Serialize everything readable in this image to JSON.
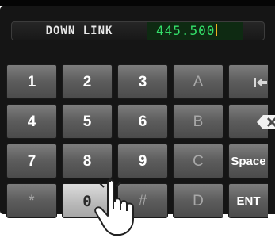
{
  "display": {
    "mode": "DOWN LINK",
    "frequency": "445.500"
  },
  "keypad": {
    "row1": [
      "1",
      "2",
      "3",
      "A",
      ""
    ],
    "row2": [
      "4",
      "5",
      "6",
      "B",
      ""
    ],
    "row3": [
      "7",
      "8",
      "9",
      "C",
      "Space"
    ],
    "row4": [
      "*",
      "0",
      "#",
      "D",
      "ENT"
    ]
  },
  "icons": {
    "row1_last": "cursor-left-right-icon",
    "row2_last": "backspace-icon",
    "pointer": "pointing-hand-icon"
  },
  "colors": {
    "frequency_text": "#34e06a",
    "cursor": "#f0b020",
    "selected_key": "#c8c8c8"
  }
}
